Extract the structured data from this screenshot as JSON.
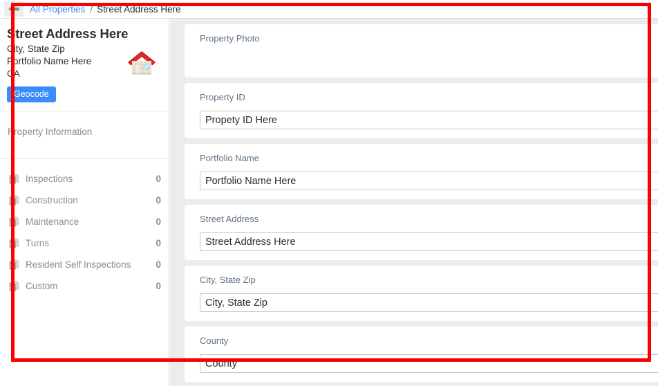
{
  "breadcrumb": {
    "back_icon": "arrow-left-icon",
    "link_label": "All Properties",
    "separator": "/",
    "current_label": "Street Address Here"
  },
  "sidebar": {
    "property": {
      "title": "Street Address Here",
      "city_state_zip": "City, State Zip",
      "portfolio_name": "Portfolio Name Here",
      "state": "CA",
      "house_icon": "house-icon",
      "geocode_label": "Geocode"
    },
    "section_heading": "Property Information",
    "items": [
      {
        "icon": "documents-icon",
        "label": "Inspections",
        "count": "0"
      },
      {
        "icon": "documents-icon",
        "label": "Construction",
        "count": "0"
      },
      {
        "icon": "documents-icon",
        "label": "Maintenance",
        "count": "0"
      },
      {
        "icon": "documents-icon",
        "label": "Turns",
        "count": "0"
      },
      {
        "icon": "documents-icon",
        "label": "Resident Self Inspections",
        "count": "0"
      },
      {
        "icon": "documents-icon",
        "label": "Custom",
        "count": "0"
      }
    ]
  },
  "main": {
    "fields": [
      {
        "label": "Property Photo",
        "value": "",
        "has_input": false
      },
      {
        "label": "Property ID",
        "value": "Propety ID Here",
        "has_input": true
      },
      {
        "label": "Portfolio Name",
        "value": "Portfolio Name Here",
        "has_input": true
      },
      {
        "label": "Street Address",
        "value": "Street Address Here",
        "has_input": true
      },
      {
        "label": "City, State Zip",
        "value": "City, State Zip",
        "has_input": true
      },
      {
        "label": "County",
        "value": "County",
        "has_input": true
      }
    ]
  },
  "colors": {
    "accent_blue": "#3b8cfb",
    "highlight_red": "#fb0000",
    "label_slate": "#5f7183",
    "muted_gray": "#8b8b8b",
    "panel_gray": "#ececec"
  }
}
